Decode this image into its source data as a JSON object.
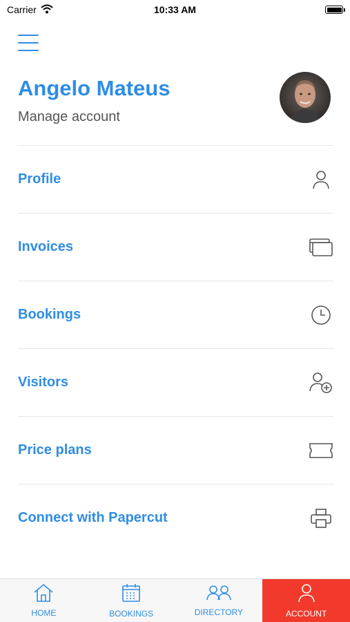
{
  "status_bar": {
    "carrier": "Carrier",
    "time": "10:33 AM"
  },
  "header": {
    "user_name": "Angelo Mateus",
    "subtitle": "Manage account"
  },
  "menu": {
    "items": [
      {
        "label": "Profile",
        "icon": "person-icon"
      },
      {
        "label": "Invoices",
        "icon": "cards-icon"
      },
      {
        "label": "Bookings",
        "icon": "clock-icon"
      },
      {
        "label": "Visitors",
        "icon": "add-person-icon"
      },
      {
        "label": "Price plans",
        "icon": "ticket-icon"
      },
      {
        "label": "Connect with Papercut",
        "icon": "printer-icon"
      }
    ]
  },
  "tab_bar": {
    "tabs": [
      {
        "label": "HOME",
        "icon": "home-icon"
      },
      {
        "label": "BOOKINGS",
        "icon": "calendar-icon"
      },
      {
        "label": "DIRECTORY",
        "icon": "people-icon"
      },
      {
        "label": "ACCOUNT",
        "icon": "person-icon",
        "active": true
      }
    ]
  },
  "colors": {
    "accent": "#2f8de4",
    "active_tab": "#f23a2c",
    "icon_gray": "#555555"
  }
}
